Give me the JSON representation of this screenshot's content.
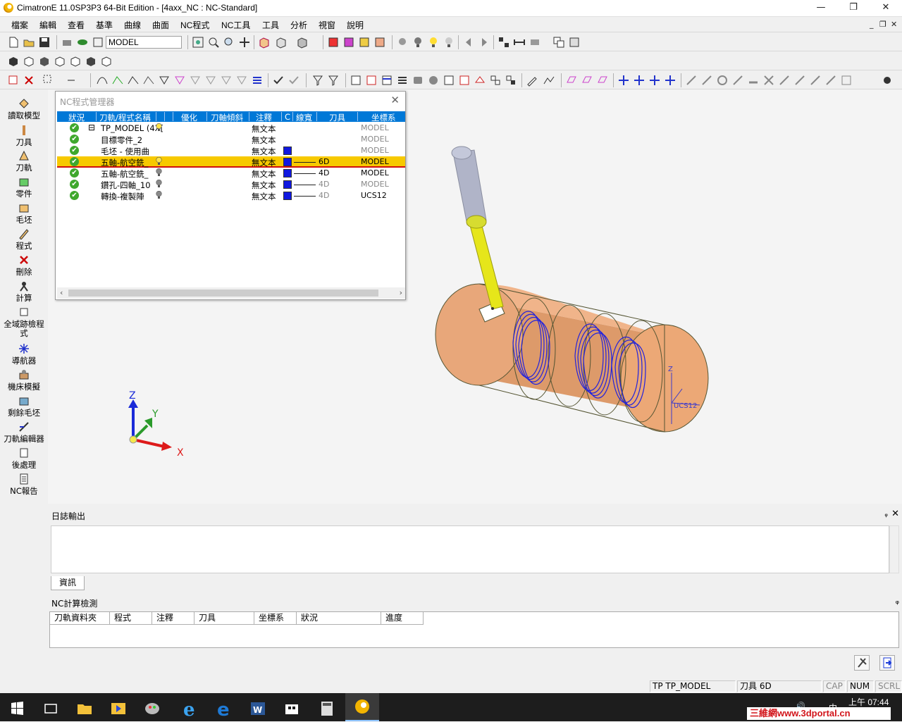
{
  "window": {
    "title": "CimatronE 11.0SP3P3 64-Bit Edition - [4axx_NC : NC-Standard]",
    "minimize": "—",
    "maximize": "❐",
    "close": "✕"
  },
  "menu": {
    "items": [
      "檔案",
      "編輯",
      "查看",
      "基準",
      "曲線",
      "曲面",
      "NC程式",
      "NC工具",
      "工具",
      "分析",
      "視窗",
      "說明"
    ],
    "mdi_controls": [
      "_",
      "❐",
      "✕"
    ]
  },
  "toolbar": {
    "model_combo": "MODEL"
  },
  "left_panel": {
    "items": [
      {
        "label": "讀取模型",
        "icon": "load-model-icon"
      },
      {
        "label": "刀具",
        "icon": "tool-icon"
      },
      {
        "label": "刀軌",
        "icon": "toolpath-icon"
      },
      {
        "label": "零件",
        "icon": "part-icon"
      },
      {
        "label": "毛坯",
        "icon": "stock-icon"
      },
      {
        "label": "程式",
        "icon": "procedure-icon"
      },
      {
        "label": "刪除",
        "icon": "delete-icon"
      },
      {
        "label": "計算",
        "icon": "calculate-icon"
      },
      {
        "label": "全域跡檢程式",
        "icon": "global-check-icon"
      },
      {
        "label": "導航器",
        "icon": "navigator-icon"
      },
      {
        "label": "機床模擬",
        "icon": "machine-sim-icon"
      },
      {
        "label": "剩餘毛坯",
        "icon": "remaining-stock-icon"
      },
      {
        "label": "刀軌編輯器",
        "icon": "toolpath-editor-icon"
      },
      {
        "label": "後處理",
        "icon": "post-process-icon"
      },
      {
        "label": "NC報告",
        "icon": "nc-report-icon"
      }
    ]
  },
  "nc_manager": {
    "title": "NC程式管理器",
    "close": "✕",
    "columns": [
      "狀況",
      "刀軌/程式名稱",
      "優化",
      "刀軸傾斜",
      "注釋",
      "C",
      "線寬",
      "刀具",
      "坐標系"
    ],
    "rows": [
      {
        "name": "TP_MODEL (4X[",
        "note": "無文本",
        "tool": "",
        "coord": "MODEL",
        "tree": "⊟",
        "indent": 0,
        "has_color": false,
        "bulb": "yellow",
        "selected": false
      },
      {
        "name": "目標零件_2",
        "note": "無文本",
        "tool": "",
        "coord": "MODEL",
        "tree": "",
        "indent": 1,
        "has_color": false,
        "bulb": "none",
        "selected": false
      },
      {
        "name": "毛坯 - 使用曲",
        "note": "無文本",
        "tool": "",
        "coord": "MODEL",
        "tree": "",
        "indent": 1,
        "has_color": true,
        "bulb": "none",
        "selected": false
      },
      {
        "name": "五軸-航空銑_",
        "note": "無文本",
        "tool": "6D",
        "coord": "MODEL",
        "tree": "",
        "indent": 1,
        "has_color": true,
        "bulb": "yellow",
        "selected": true
      },
      {
        "name": "五軸-航空銑_",
        "note": "無文本",
        "tool": "4D",
        "coord": "MODEL",
        "tree": "",
        "indent": 1,
        "has_color": true,
        "bulb": "gray",
        "selected": false
      },
      {
        "name": "鑽孔-四軸_10",
        "note": "無文本",
        "tool": "4D",
        "coord": "MODEL",
        "tree": "",
        "indent": 1,
        "has_color": true,
        "bulb": "gray",
        "selected": false
      },
      {
        "name": "轉換-複製陣",
        "note": "無文本",
        "tool": "4D",
        "coord": "UCS12",
        "tree": "",
        "indent": 1,
        "has_color": true,
        "bulb": "gray",
        "selected": false
      }
    ]
  },
  "viewport": {
    "axes": {
      "x": "X",
      "y": "Y",
      "z": "Z"
    },
    "part_ucs_label": "UCS12",
    "colors": {
      "part": "#e8a77a",
      "toolpath": "#2222dd",
      "tool": "#e6e61a",
      "holder": "#b0b4c8"
    }
  },
  "log_panel": {
    "title": "日誌輸出",
    "pin": "ᵩ",
    "close": "✕",
    "tab": "資訊"
  },
  "nc_calc": {
    "title": "NC計算檢測",
    "pin": "ᵩ",
    "columns": [
      "刀軌資料夾",
      "程式",
      "注釋",
      "刀具",
      "坐標系",
      "狀況",
      "進度"
    ]
  },
  "status_bar": {
    "tp": "TP  TP_MODEL",
    "tool": "刀具  6D",
    "cap": "CAP",
    "num": "NUM",
    "scrl": "SCRL"
  },
  "taskbar": {
    "time": "上午 07:44",
    "ime": "中",
    "watermark": "三維網www.3dportal.cn"
  }
}
